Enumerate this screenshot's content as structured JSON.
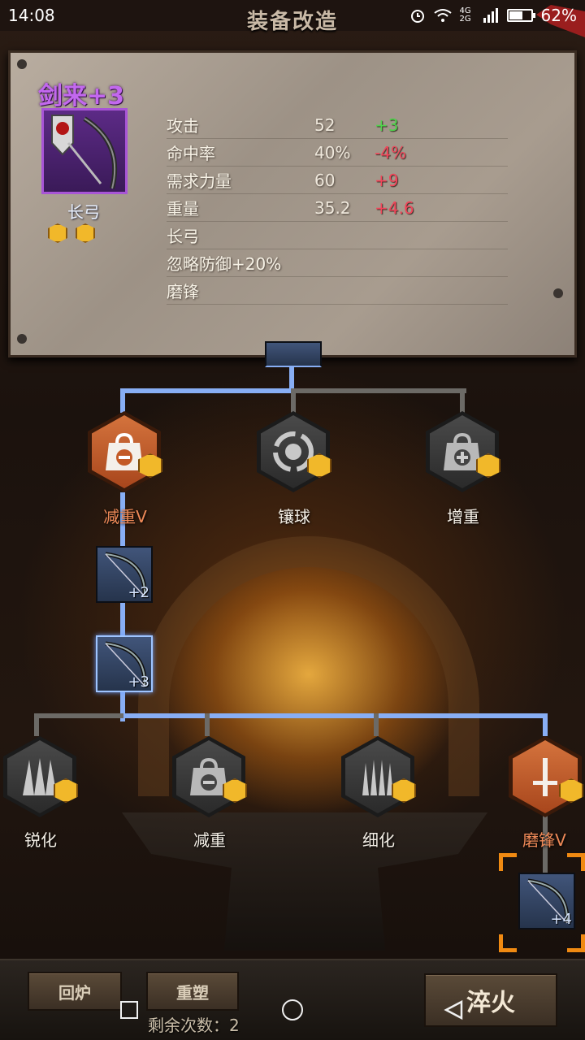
{
  "status_bar": {
    "time": "14:08",
    "network": "4G 2G",
    "battery": "62%",
    "battery_level": 0.62
  },
  "header": {
    "title": "装备改造"
  },
  "item": {
    "name": "剑来+3",
    "type": "长弓",
    "gem_count": 2,
    "stats": [
      {
        "label": "攻击",
        "value": "52",
        "delta": "+3",
        "trend": "up"
      },
      {
        "label": "命中率",
        "value": "40%",
        "delta": "-4%",
        "trend": "down"
      },
      {
        "label": "需求力量",
        "value": "60",
        "delta": "+9",
        "trend": "down"
      },
      {
        "label": "重量",
        "value": "35.2",
        "delta": "+4.6",
        "trend": "down"
      }
    ],
    "traits": [
      "长弓",
      "忽略防御+20%",
      "磨锋"
    ]
  },
  "tree": {
    "upper_nodes": [
      {
        "label": "减重V",
        "icon": "weight-minus-icon",
        "active": true
      },
      {
        "label": "镶球",
        "icon": "socket-orb-icon",
        "active": false
      },
      {
        "label": "增重",
        "icon": "weight-plus-icon",
        "active": false
      }
    ],
    "bow_cards": [
      "+2",
      "+3",
      "+4"
    ],
    "lower_nodes": [
      {
        "label": "锐化",
        "icon": "sharpen-icon",
        "active": false
      },
      {
        "label": "减重",
        "icon": "weight-minus-icon",
        "active": false
      },
      {
        "label": "细化",
        "icon": "refine-icon",
        "active": false
      },
      {
        "label": "磨锋V",
        "icon": "sword-icon",
        "active": true
      }
    ]
  },
  "buttons": {
    "recycle": "回炉",
    "reshape": "重塑",
    "quench": "淬火",
    "remaining_label": "剩余次数：2"
  },
  "colors": {
    "accent_purple": "#c268ee",
    "line_blue": "#88aef4",
    "active_orange": "#d4733d",
    "gem_gold": "#f1b82a",
    "stat_up": "#4fd34b",
    "stat_down": "#f2455a"
  }
}
